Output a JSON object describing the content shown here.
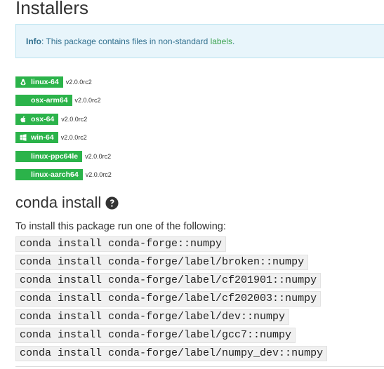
{
  "installers": {
    "heading": "Installers",
    "info": {
      "lead": "Info",
      "text_before_link": ": This package contains files in non-standard ",
      "link": "labels",
      "text_after_link": "."
    },
    "platforms": [
      {
        "name": "linux-64",
        "version": "v2.0.0rc2",
        "icon": "linux-icon"
      },
      {
        "name": "osx-arm64",
        "version": "v2.0.0rc2",
        "icon": "none"
      },
      {
        "name": "osx-64",
        "version": "v2.0.0rc2",
        "icon": "apple-icon"
      },
      {
        "name": "win-64",
        "version": "v2.0.0rc2",
        "icon": "windows-icon"
      },
      {
        "name": "linux-ppc64le",
        "version": "v2.0.0rc2",
        "icon": "none"
      },
      {
        "name": "linux-aarch64",
        "version": "v2.0.0rc2",
        "icon": "none"
      }
    ],
    "badge_color": "#2bb34a"
  },
  "conda": {
    "title": "conda install",
    "help_icon": "question-circle-icon",
    "description": "To install this package run one of the following:",
    "commands": [
      "conda install conda-forge::numpy",
      "conda install conda-forge/label/broken::numpy",
      "conda install conda-forge/label/cf201901::numpy",
      "conda install conda-forge/label/cf202003::numpy",
      "conda install conda-forge/label/dev::numpy",
      "conda install conda-forge/label/gcc7::numpy",
      "conda install conda-forge/label/numpy_dev::numpy"
    ]
  }
}
